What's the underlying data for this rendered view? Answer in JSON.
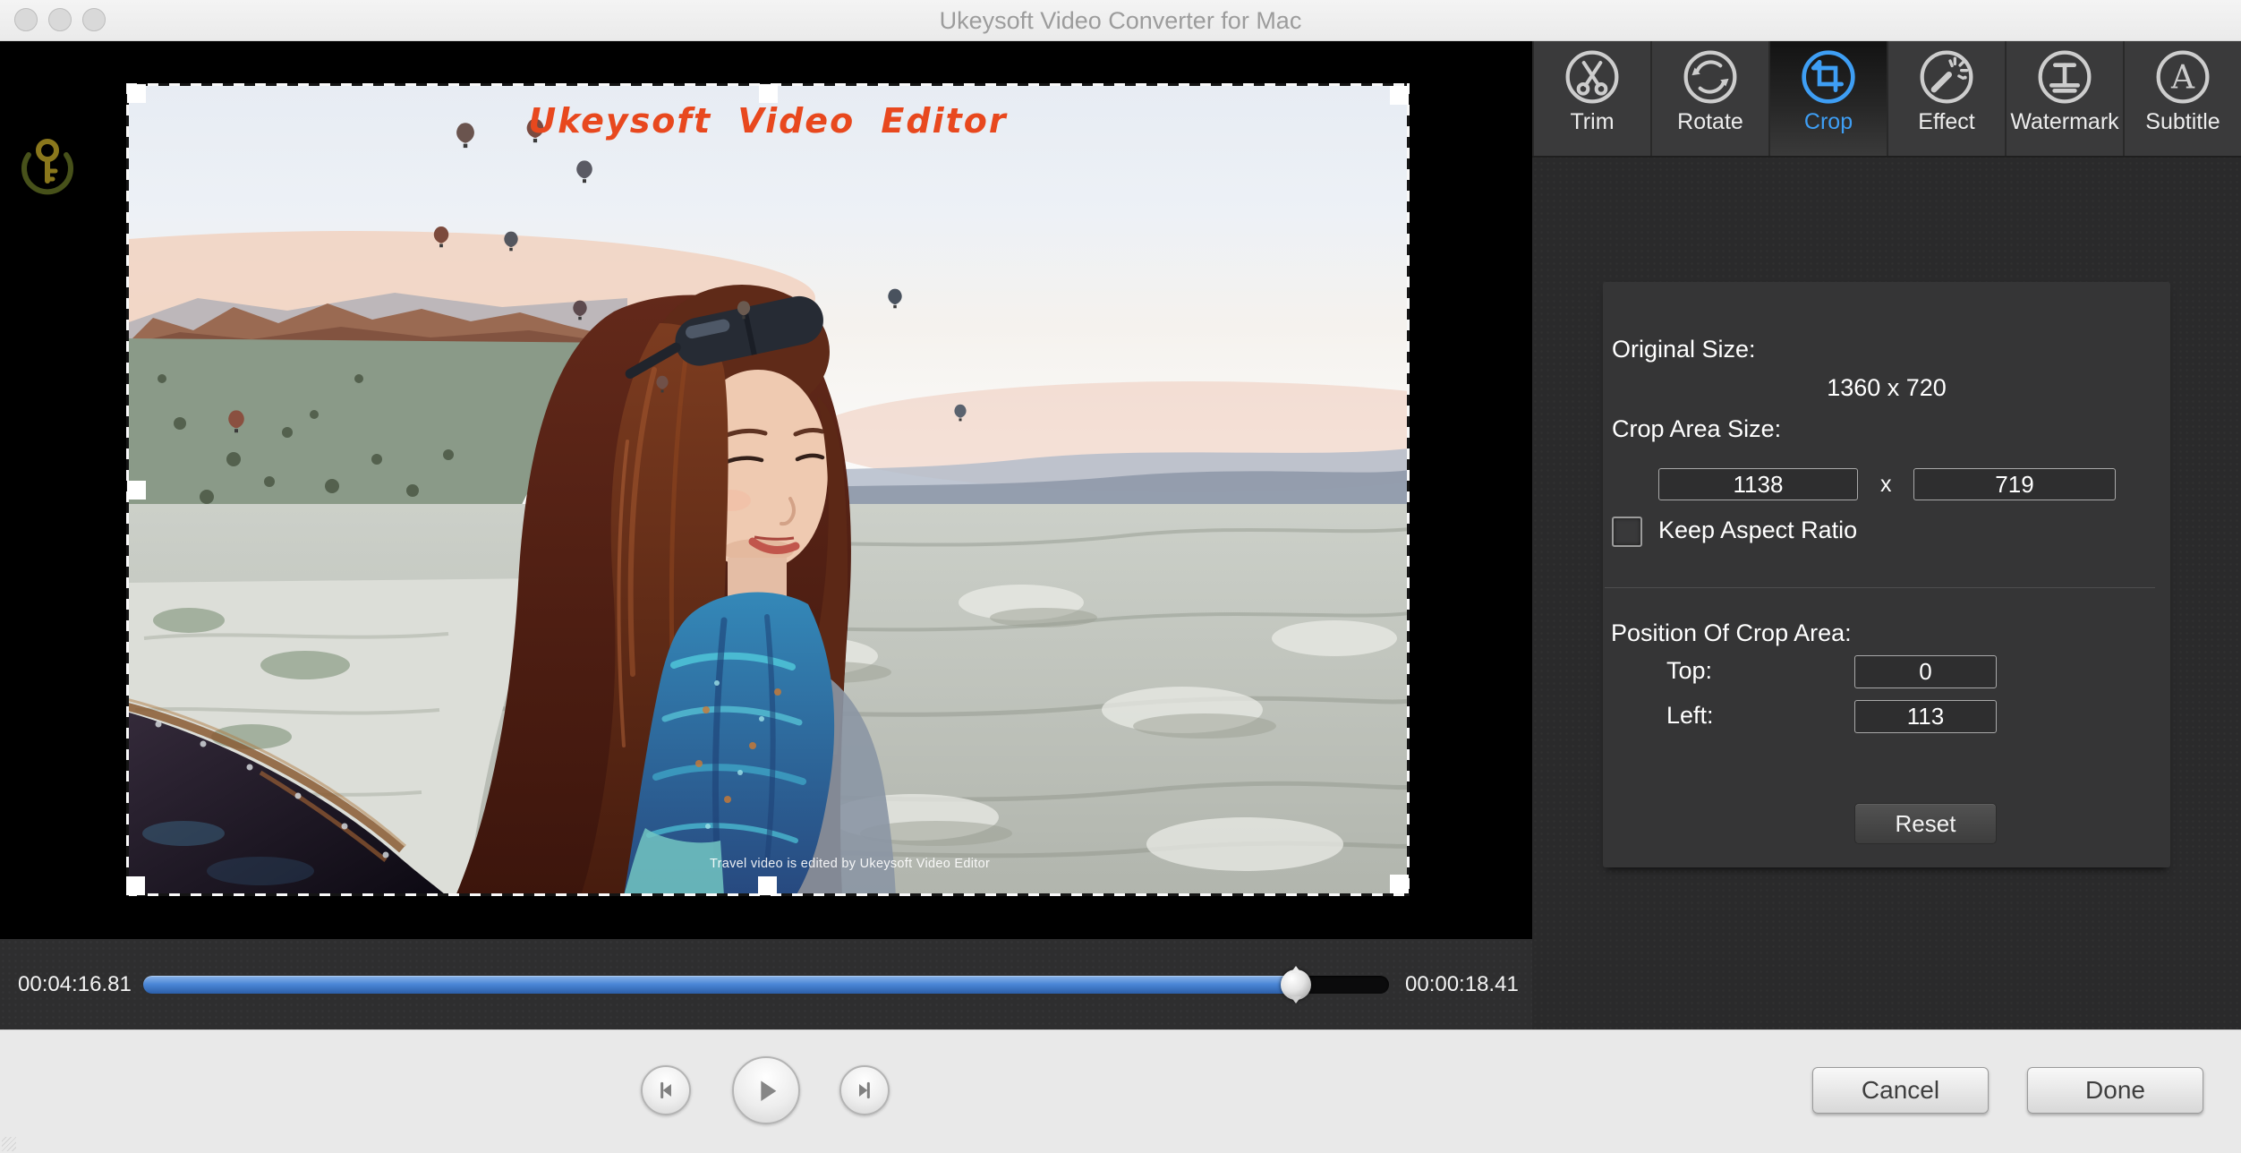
{
  "window": {
    "title": "Ukeysoft Video Converter for Mac"
  },
  "colors": {
    "accent_blue": "#3E9EF4",
    "watermark_red": "#E8481E"
  },
  "toolbar": {
    "items": [
      {
        "label": "Trim",
        "selected": false
      },
      {
        "label": "Rotate",
        "selected": false
      },
      {
        "label": "Crop",
        "selected": true
      },
      {
        "label": "Effect",
        "selected": false
      },
      {
        "label": "Watermark",
        "selected": false
      },
      {
        "label": "Subtitle",
        "selected": false
      }
    ]
  },
  "video": {
    "brand_watermark": "Ukeysoft Video Editor",
    "caption": "Travel video is edited by Ukeysoft Video Editor"
  },
  "timeline": {
    "current_time": "00:04:16.81",
    "total_time": "00:00:18.41",
    "progress_percent": 92.5
  },
  "crop_panel": {
    "original_size_label": "Original Size:",
    "original_size_value": "1360 x 720",
    "crop_area_size_label": "Crop Area Size:",
    "crop_width_value": "1138",
    "dimension_separator": "x",
    "crop_height_value": "719",
    "keep_aspect_ratio_label": "Keep Aspect Ratio",
    "keep_aspect_ratio_checked": false,
    "position_label": "Position Of Crop Area:",
    "top_label": "Top:",
    "top_value": "0",
    "left_label": "Left:",
    "left_value": "113",
    "reset_label": "Reset"
  },
  "footer": {
    "cancel_label": "Cancel",
    "done_label": "Done"
  }
}
